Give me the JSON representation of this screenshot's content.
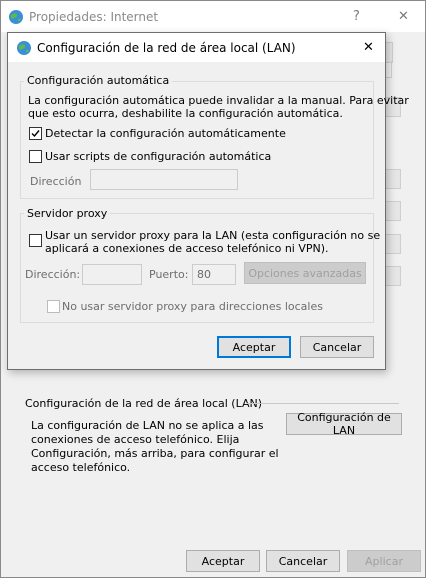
{
  "parent": {
    "title": "Propiedades: Internet",
    "help_glyph": "?",
    "close_glyph": "✕",
    "lan_section_title": "Configuración de la red de área local (LAN)",
    "lan_section_desc": [
      "La configuración de LAN no se aplica a las",
      "conexiones de acceso telefónico. Elija",
      "Configuración, más arriba, para configurar el",
      "acceso telefónico."
    ],
    "lan_button": "Configuración de LAN",
    "ok": "Aceptar",
    "cancel": "Cancelar",
    "apply": "Aplicar"
  },
  "dialog": {
    "title": "Configuración de la red de área local (LAN)",
    "close_glyph": "✕",
    "auto_group": {
      "title": "Configuración automática",
      "desc": [
        "La configuración automática puede invalidar a la manual. Para evitar",
        "que esto ocurra, deshabilite la configuración automática."
      ],
      "detect": {
        "label": "Detectar la configuración automáticamente",
        "checked": true
      },
      "scripts": {
        "label": "Usar scripts de configuración automática",
        "checked": false
      },
      "address_label": "Dirección",
      "address_value": ""
    },
    "proxy_group": {
      "title": "Servidor proxy",
      "use_proxy": {
        "label_lines": [
          "Usar un servidor proxy para la LAN (esta configuración no se",
          "aplicará a conexiones de acceso telefónico ni VPN)."
        ],
        "checked": false
      },
      "address_label": "Dirección:",
      "address_value": "",
      "port_label": "Puerto:",
      "port_value": "80",
      "advanced_button": "Opciones avanzadas",
      "bypass": {
        "label": "No usar servidor proxy para direcciones locales",
        "checked": false
      }
    },
    "ok": "Aceptar",
    "cancel": "Cancelar"
  }
}
